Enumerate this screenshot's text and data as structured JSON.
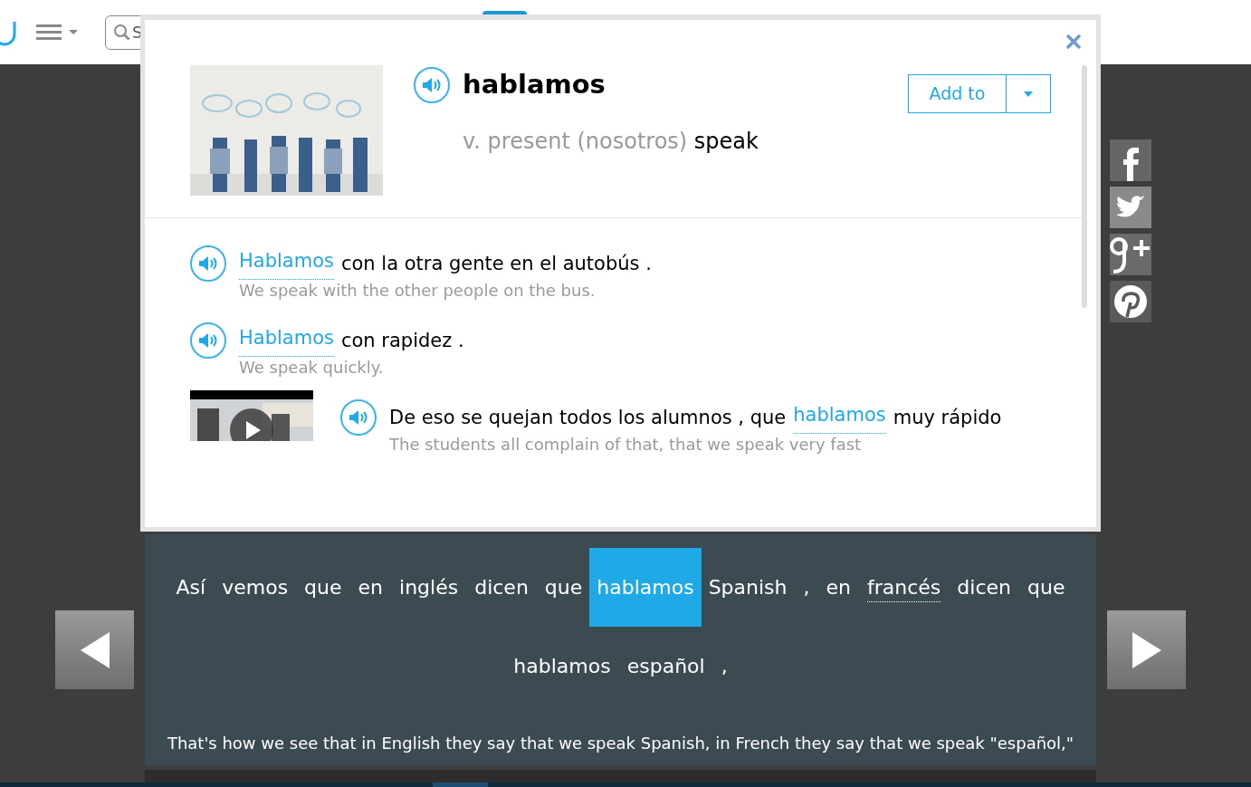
{
  "header": {
    "search": {
      "placeholder": "S"
    }
  },
  "entry": {
    "word": "hablamos",
    "grammar": "v. present (nosotros)",
    "meaning": "speak",
    "add_button": "Add to"
  },
  "examples": [
    {
      "kind": "text",
      "segments": [
        {
          "text": "Hablamos",
          "link": true
        },
        {
          "text": "con la otra gente en el autobús .",
          "link": false
        }
      ],
      "translation": "We speak with the other people on the bus."
    },
    {
      "kind": "text",
      "segments": [
        {
          "text": "Hablamos",
          "link": true
        },
        {
          "text": "con rapidez .",
          "link": false
        }
      ],
      "translation": "We speak quickly."
    },
    {
      "kind": "video",
      "segments": [
        {
          "text": "De eso se quejan todos los alumnos , que",
          "link": false
        },
        {
          "text": "hablamos",
          "link": true
        },
        {
          "text": "muy rápido",
          "link": false
        }
      ],
      "translation": "The students all complain of that, that we speak very fast"
    }
  ],
  "subtitle": {
    "words": [
      {
        "text": "Así",
        "selected": false,
        "linked": false
      },
      {
        "text": "vemos",
        "selected": false,
        "linked": false
      },
      {
        "text": "que",
        "selected": false,
        "linked": false
      },
      {
        "text": "en",
        "selected": false,
        "linked": false
      },
      {
        "text": "inglés",
        "selected": false,
        "linked": false
      },
      {
        "text": "dicen",
        "selected": false,
        "linked": false
      },
      {
        "text": "que",
        "selected": false,
        "linked": false
      },
      {
        "text": "hablamos",
        "selected": true,
        "linked": false
      },
      {
        "text": "Spanish",
        "selected": false,
        "linked": false
      },
      {
        "text": ",",
        "selected": false,
        "linked": false
      },
      {
        "text": "en",
        "selected": false,
        "linked": false
      },
      {
        "text": "francés",
        "selected": false,
        "linked": true
      },
      {
        "text": "dicen",
        "selected": false,
        "linked": false
      },
      {
        "text": "que",
        "selected": false,
        "linked": false
      },
      {
        "text": "hablamos",
        "selected": false,
        "linked": false
      },
      {
        "text": "español",
        "selected": false,
        "linked": false
      },
      {
        "text": ",",
        "selected": false,
        "linked": false
      }
    ],
    "translation": "That's how we see that in English they say that we speak Spanish, in French they say that we speak \"español,\""
  }
}
